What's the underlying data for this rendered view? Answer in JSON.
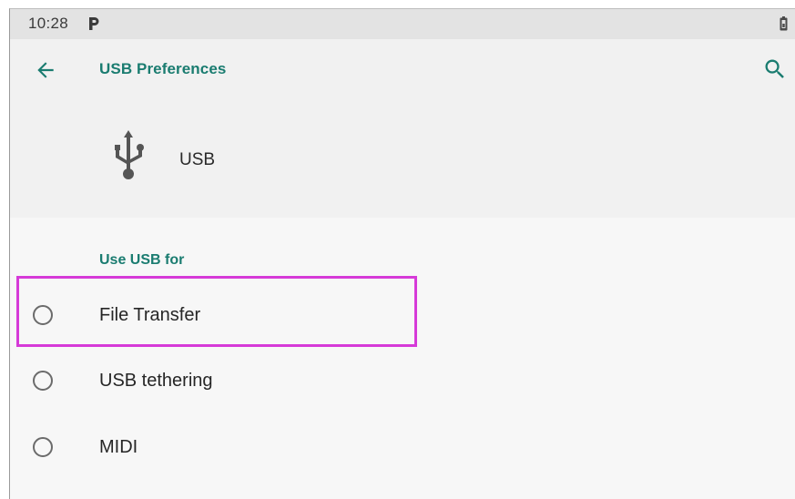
{
  "status_bar": {
    "time": "10:28",
    "notification_icon": "parking-p-icon",
    "battery_icon": "battery-icon"
  },
  "header": {
    "title": "USB Preferences",
    "back_icon": "arrow-left-icon",
    "search_icon": "search-icon",
    "device_icon": "usb-icon",
    "device_label": "USB"
  },
  "section": {
    "title": "Use USB for",
    "options": [
      {
        "label": "File Transfer",
        "selected": false,
        "highlighted": true
      },
      {
        "label": "USB tethering",
        "selected": false,
        "highlighted": false
      },
      {
        "label": "MIDI",
        "selected": false,
        "highlighted": false
      }
    ]
  },
  "colors": {
    "accent": "#1a7c70",
    "highlight": "#d63ad8",
    "status_bar_bg": "#e3e3e3",
    "header_bg": "#f1f1f1",
    "content_bg": "#f7f7f7",
    "text": "#262626"
  }
}
